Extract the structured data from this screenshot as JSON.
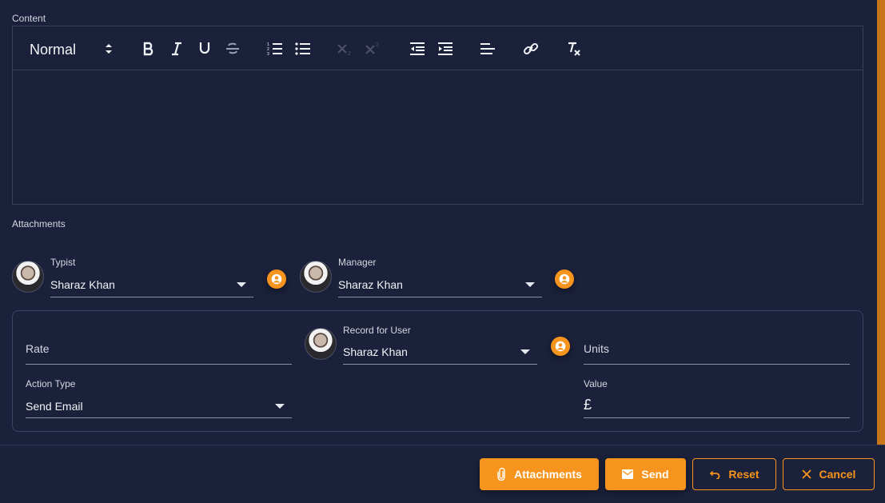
{
  "content_label": "Content",
  "toolbar": {
    "format_value": "Normal",
    "buttons": [
      "bold-icon",
      "italic-icon",
      "underline-icon",
      "strikethrough-icon",
      "ordered-list-icon",
      "bullet-list-icon",
      "subscript-icon",
      "superscript-icon",
      "outdent-icon",
      "indent-icon",
      "align-left-icon",
      "link-icon",
      "clear-format-icon"
    ]
  },
  "attachments_label": "Attachments",
  "typist": {
    "label": "Typist",
    "value": "Sharaz Khan"
  },
  "manager": {
    "label": "Manager",
    "value": "Sharaz Khan"
  },
  "panel": {
    "rate_placeholder": "Rate",
    "record_for_user": {
      "label": "Record for User",
      "value": "Sharaz Khan"
    },
    "units_placeholder": "Units",
    "action_type": {
      "label": "Action Type",
      "value": "Send Email"
    },
    "value": {
      "label": "Value",
      "prefix": "£"
    }
  },
  "footer": {
    "attachments": "Attachments",
    "send": "Send",
    "reset": "Reset",
    "cancel": "Cancel"
  },
  "colors": {
    "accent": "#f7941d",
    "background": "#1b213a",
    "side_bar": "#c8761a"
  }
}
